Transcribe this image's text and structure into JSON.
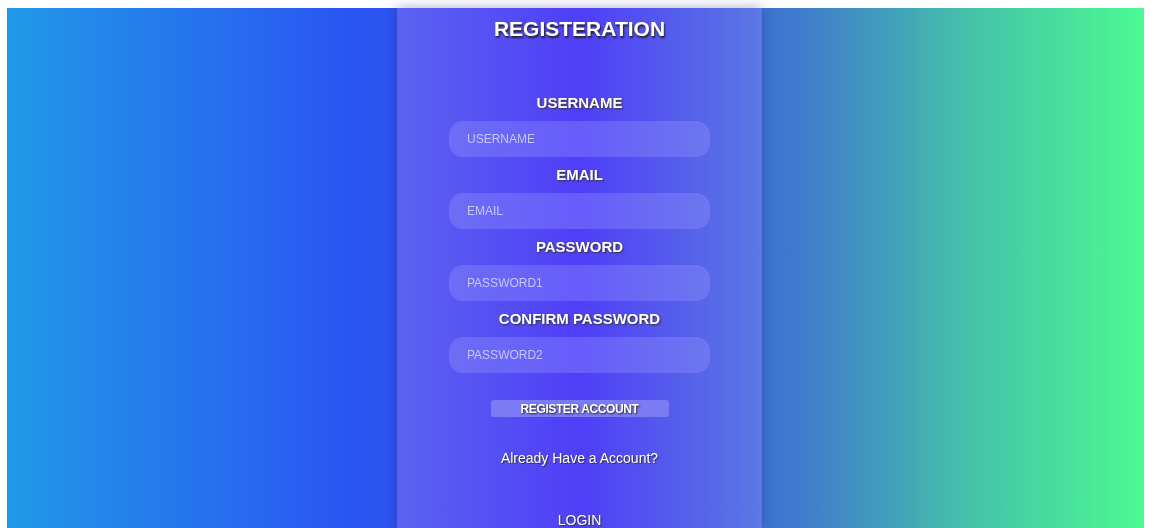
{
  "title": "REGISTERATION",
  "fields": [
    {
      "label": "USERNAME",
      "placeholder": "USERNAME"
    },
    {
      "label": "EMAIL",
      "placeholder": "EMAIL"
    },
    {
      "label": "PASSWORD",
      "placeholder": "PASSWORD1"
    },
    {
      "label": "CONFIRM PASSWORD",
      "placeholder": "PASSWORD2"
    }
  ],
  "register_button": "REGISTER ACCOUNT",
  "prompt": "Already Have a Account?",
  "login_link": "LOGIN"
}
